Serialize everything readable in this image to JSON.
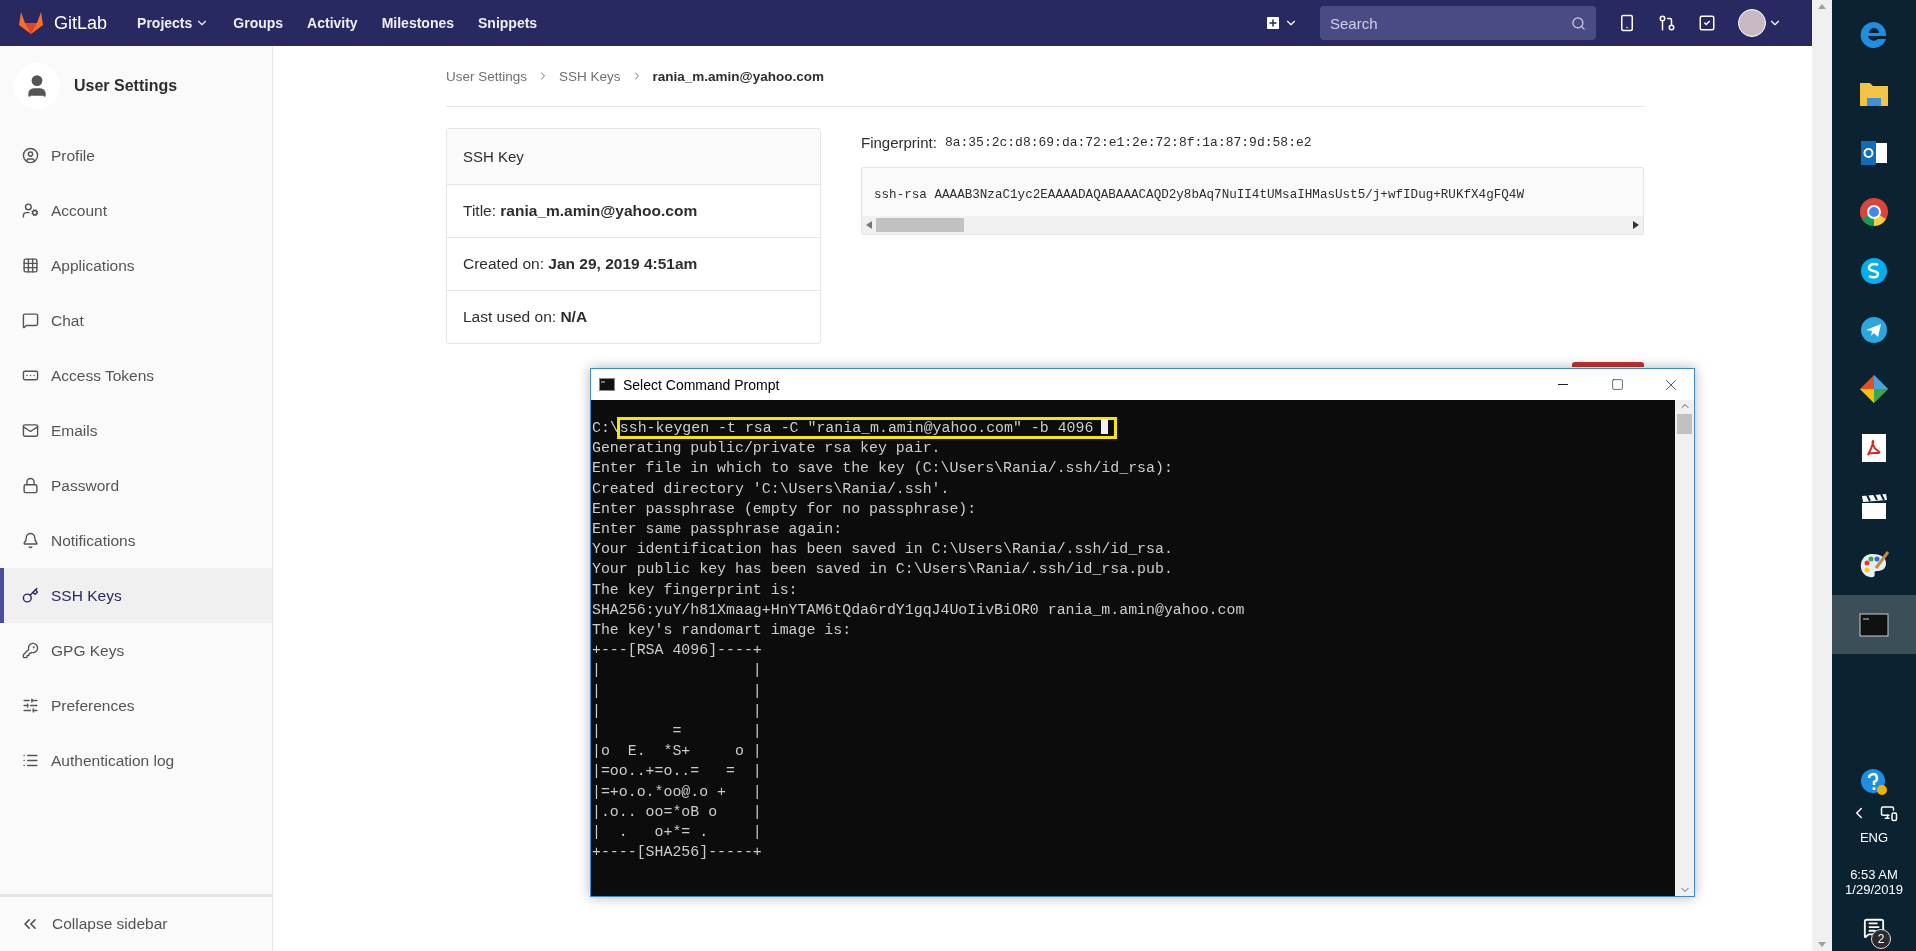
{
  "nav": {
    "brand": "GitLab",
    "links": [
      {
        "label": "Projects",
        "dropdown": true
      },
      {
        "label": "Groups",
        "dropdown": false
      },
      {
        "label": "Activity",
        "dropdown": false
      },
      {
        "label": "Milestones",
        "dropdown": false
      },
      {
        "label": "Snippets",
        "dropdown": false
      }
    ],
    "search": {
      "placeholder": "Search"
    }
  },
  "sidebar": {
    "title": "User Settings",
    "items": [
      {
        "label": "Profile",
        "selected": false
      },
      {
        "label": "Account",
        "selected": false
      },
      {
        "label": "Applications",
        "selected": false
      },
      {
        "label": "Chat",
        "selected": false
      },
      {
        "label": "Access Tokens",
        "selected": false
      },
      {
        "label": "Emails",
        "selected": false
      },
      {
        "label": "Password",
        "selected": false
      },
      {
        "label": "Notifications",
        "selected": false
      },
      {
        "label": "SSH Keys",
        "selected": true
      },
      {
        "label": "GPG Keys",
        "selected": false
      },
      {
        "label": "Preferences",
        "selected": false
      },
      {
        "label": "Authentication log",
        "selected": false
      }
    ],
    "collapse": "Collapse sidebar"
  },
  "breadcrumb": [
    "User Settings",
    "SSH Keys",
    "rania_m.amin@yahoo.com"
  ],
  "key_card": {
    "heading": "SSH Key",
    "fields": [
      {
        "label": "Title:",
        "value": "rania_m.amin@yahoo.com"
      },
      {
        "label": "Created on:",
        "value": "Jan 29, 2019 4:51am"
      },
      {
        "label": "Last used on:",
        "value": "N/A"
      }
    ]
  },
  "fingerprint": {
    "label": "Fingerprint:",
    "value": "8a:35:2c:d8:69:da:72:e1:2e:72:8f:1a:87:9d:58:e2"
  },
  "public_key": "ssh-rsa AAAAB3NzaC1yc2EAAAADAQABAAACAQD2y8bAq7NuII4tUMsaIHMasUst5/j+wfIDug+RUKfX4gFQ4W",
  "terminal": {
    "title": "Select Command Prompt",
    "prompt": "C:\\",
    "command": "ssh-keygen -t rsa -C \"rania_m.amin@yahoo.com\" -b 4096",
    "lines": [
      "Generating public/private rsa key pair.",
      "Enter file in which to save the key (C:\\Users\\Rania/.ssh/id_rsa):",
      "Created directory 'C:\\Users\\Rania/.ssh'.",
      "Enter passphrase (empty for no passphrase):",
      "Enter same passphrase again:",
      "Your identification has been saved in C:\\Users\\Rania/.ssh/id_rsa.",
      "Your public key has been saved in C:\\Users\\Rania/.ssh/id_rsa.pub.",
      "The key fingerprint is:",
      "SHA256:yuY/h81Xmaag+HnYTAM6tQda6rdY1gqJ4UoIivBiOR0 rania_m.amin@yahoo.com",
      "The key's randomart image is:",
      "+---[RSA 4096]----+",
      "|                 |",
      "|                 |",
      "|                 |",
      "|        =        |",
      "|o  E.  *S+     o |",
      "|=oo..+=o..=   =  |",
      "|=+o.o.*oo@.o +   |",
      "|.o.. oo=*oB o    |",
      "|  .   o+*= .     |",
      "+----[SHA256]-----+"
    ]
  },
  "taskbar": {
    "language": "ENG",
    "time": "6:53 AM",
    "date": "1/29/2019",
    "notifications": "2"
  }
}
